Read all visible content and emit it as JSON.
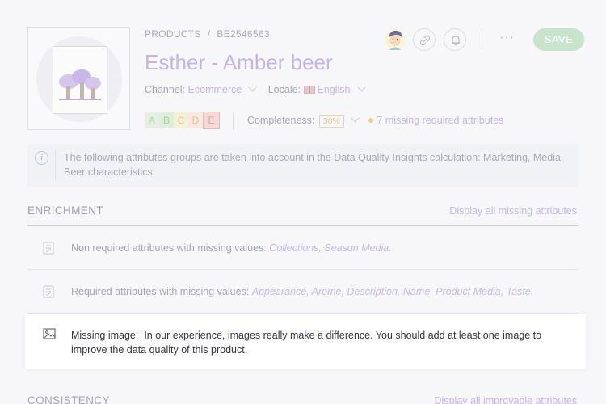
{
  "breadcrumb": {
    "section": "PRODUCTS",
    "separator": "/",
    "code": "BE2546563"
  },
  "product": {
    "title": "Esther - Amber beer"
  },
  "channel": {
    "label": "Channel:",
    "value": "Ecommerce"
  },
  "locale": {
    "label": "Locale:",
    "value": "English"
  },
  "grades": [
    "A",
    "B",
    "C",
    "D",
    "E"
  ],
  "completeness": {
    "label": "Completeness:",
    "value": "30%"
  },
  "missing": {
    "text": "7 missing required attributes",
    "dot_color": "#efcc92"
  },
  "toolbar": {
    "more": "···",
    "save_label": "SAVE"
  },
  "info": {
    "icon": "i",
    "text": "The following attributes groups are taken into account in the Data Quality Insights calculation: Marketing, Media, Beer characteristics."
  },
  "enrichment": {
    "title": "ENRICHMENT",
    "link": "Display all missing attributes",
    "rows": [
      {
        "label": "Non required attributes with missing values:",
        "items": "Collections, Season Media."
      },
      {
        "label": "Required attributes with missing values:",
        "items": "Appearance, Arome, Description, Name, Product Media, Taste."
      }
    ],
    "image_card": {
      "label": "Missing image:",
      "text": "In our experience, images really make a difference. You should add at least one image to improve the data quality of this product."
    }
  },
  "consistency": {
    "title": "CONSISTENCY",
    "link": "Display all improvable attributes"
  },
  "colors": {
    "accent": "#9452ba",
    "save": "#67b373"
  }
}
